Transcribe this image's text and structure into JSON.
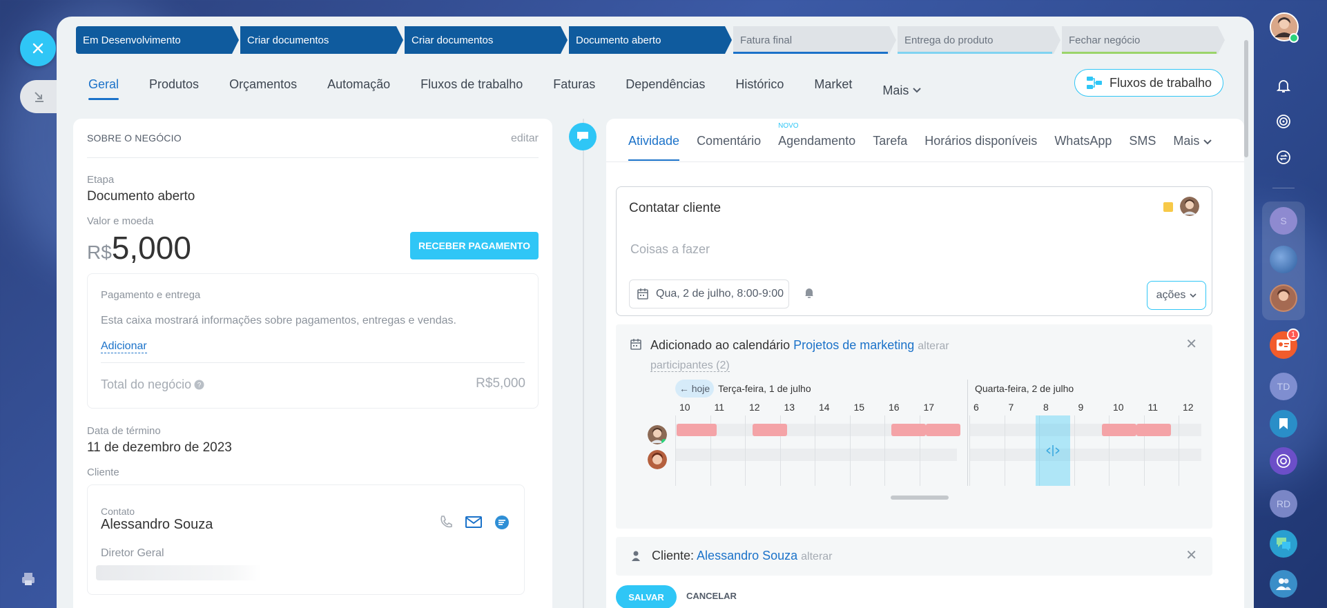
{
  "stages": [
    {
      "label": "Em Desenvolvimento",
      "state": "active"
    },
    {
      "label": "Criar documentos",
      "state": "active"
    },
    {
      "label": "Criar documentos",
      "state": "active"
    },
    {
      "label": "Documento aberto",
      "state": "active"
    },
    {
      "label": "Fatura final",
      "state": "inactive",
      "color": "#1b72c9"
    },
    {
      "label": "Entrega do produto",
      "state": "inactive",
      "color": "#7fd3f1"
    },
    {
      "label": "Fechar negócio",
      "state": "inactive",
      "color": "#9bd46a"
    }
  ],
  "tabs": {
    "geral": "Geral",
    "produtos": "Produtos",
    "orcamentos": "Orçamentos",
    "automacao": "Automação",
    "fluxos": "Fluxos de trabalho",
    "faturas": "Faturas",
    "dependencias": "Dependências",
    "historico": "Histórico",
    "market": "Market",
    "mais": "Mais"
  },
  "workflows_button": "Fluxos de trabalho",
  "about": {
    "title": "SOBRE O NEGÓCIO",
    "edit": "editar",
    "stage_label": "Etapa",
    "stage_value": "Documento aberto",
    "amount_label": "Valor e moeda",
    "currency": "R$",
    "amount": "5,000",
    "pay_button": "RECEBER PAGAMENTO",
    "payment_title": "Pagamento e entrega",
    "payment_text": "Esta caixa mostrará informações sobre pagamentos, entregas e vendas.",
    "add": "Adicionar",
    "total_label": "Total do negócio",
    "total_value": "R$5,000",
    "end_label": "Data de término",
    "end_value": "11 de dezembro de 2023",
    "client_label": "Cliente",
    "contact_label": "Contato",
    "contact_name": "Alessandro Souza",
    "contact_role": "Diretor Geral"
  },
  "activity": {
    "tabs": {
      "atividade": "Atividade",
      "comentario": "Comentário",
      "agendamento": "Agendamento",
      "novo": "NOVO",
      "tarefa": "Tarefa",
      "horarios": "Horários disponíveis",
      "whatsapp": "WhatsApp",
      "sms": "SMS",
      "mais": "Mais"
    },
    "todo_title": "Contatar cliente",
    "todo_placeholder": "Coisas a fazer",
    "todo_date": "Qua, 2 de julho, 8:00-9:00",
    "actions": "ações"
  },
  "calendar": {
    "added": "Adicionado ao calendário",
    "calendar_name": "Projetos de marketing",
    "change": "alterar",
    "participants": "participantes (2)",
    "today": "← hoje",
    "day1": "Terça-feira, 1 de julho",
    "day2": "Quarta-feira, 2 de julho",
    "hours_day1": [
      "10",
      "11",
      "12",
      "13",
      "14",
      "15",
      "16",
      "17"
    ],
    "hours_day2": [
      "6",
      "7",
      "8",
      "9",
      "10",
      "11",
      "12"
    ]
  },
  "client_row": {
    "label": "Cliente:",
    "name": "Alessandro Souza",
    "change": "alterar"
  },
  "buttons": {
    "save": "SALVAR",
    "cancel": "CANCELAR"
  },
  "notifications": {
    "badge": "1"
  },
  "rail_initials": {
    "s": "S",
    "td": "TD",
    "rd": "RD"
  }
}
